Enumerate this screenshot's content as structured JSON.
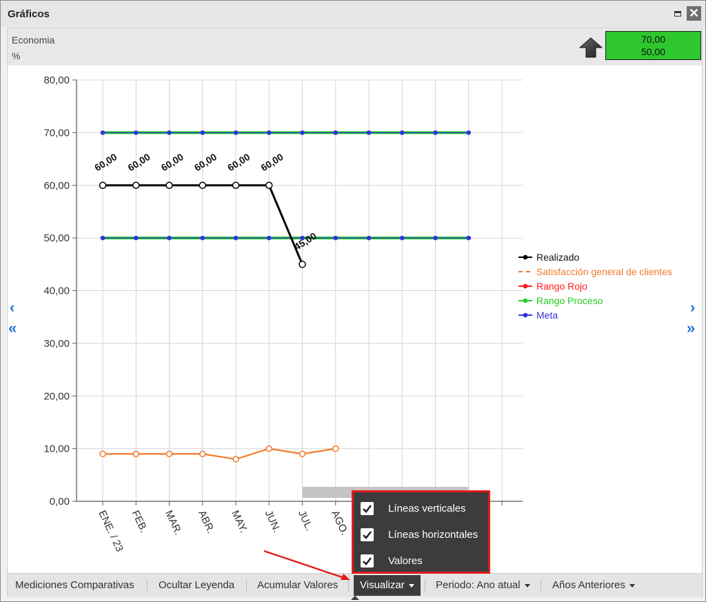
{
  "window": {
    "title": "Gráficos",
    "close_glyph": "✕"
  },
  "header": {
    "indicator_name": "Economia",
    "indicator_unit": "%",
    "trend_icon": "arrow-up-icon",
    "goal_values": [
      "70,00",
      "50,00"
    ],
    "goal_color": "#2ec72e"
  },
  "nav": {
    "prev": "‹",
    "first": "«",
    "next": "›",
    "last": "»"
  },
  "chart_data": {
    "type": "line",
    "categories": [
      "ENE. / 23",
      "FEB.",
      "MAR.",
      "ABR.",
      "MAY.",
      "JUN.",
      "JUL.",
      "AGO.",
      "",
      "",
      "",
      "",
      ""
    ],
    "y_ticks": [
      "80,00",
      "70,00",
      "60,00",
      "50,00",
      "40,00",
      "30,00",
      "20,00",
      "10,00",
      "0,00"
    ],
    "ylim": [
      0,
      80
    ],
    "grid": {
      "vertical": true,
      "horizontal": true
    },
    "series": [
      {
        "name": "Realizado",
        "color": "#000000",
        "values": [
          60,
          60,
          60,
          60,
          60,
          60,
          45
        ],
        "labels": [
          "60,00",
          "60,00",
          "60,00",
          "60,00",
          "60,00",
          "60,00",
          "45,00"
        ]
      },
      {
        "name": "Satisfacción general de clientes",
        "color": "#f07a2a",
        "values": [
          9,
          9,
          9,
          9,
          8,
          10,
          9,
          10
        ]
      },
      {
        "name": "Rango Rojo",
        "color": "#ff1a1a",
        "values": []
      },
      {
        "name": "Rango Proceso",
        "color": "#22cc22",
        "values": [
          70,
          70,
          70,
          70,
          70,
          70,
          70,
          70,
          70,
          70,
          70,
          70
        ]
      },
      {
        "name": "Meta",
        "color": "#3333dd",
        "values": [
          50,
          50,
          50,
          50,
          50,
          50,
          50,
          50,
          50,
          50,
          50,
          50
        ]
      }
    ],
    "legend_position": "right"
  },
  "toolbar": {
    "comparative": "Mediciones Comparativas",
    "hide_legend": "Ocultar Leyenda",
    "accumulate": "Acumular Valores",
    "visualize": "Visualizar",
    "period": "Periodo: Ano atual",
    "previous_years": "Años Anteriores"
  },
  "visualize_menu": {
    "items": [
      {
        "label": "Líneas verticales",
        "checked": true
      },
      {
        "label": "Líneas horizontales",
        "checked": true
      },
      {
        "label": "Valores",
        "checked": true
      }
    ]
  }
}
